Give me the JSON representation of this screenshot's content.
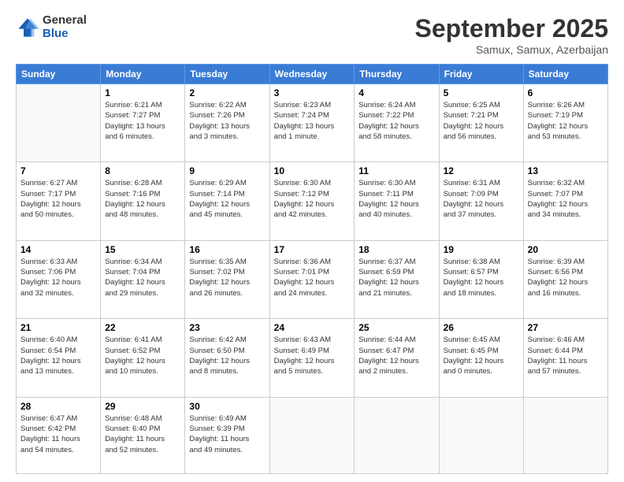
{
  "header": {
    "logo_general": "General",
    "logo_blue": "Blue",
    "title": "September 2025",
    "location": "Samux, Samux, Azerbaijan"
  },
  "days_of_week": [
    "Sunday",
    "Monday",
    "Tuesday",
    "Wednesday",
    "Thursday",
    "Friday",
    "Saturday"
  ],
  "weeks": [
    [
      {
        "day": "",
        "info": ""
      },
      {
        "day": "1",
        "info": "Sunrise: 6:21 AM\nSunset: 7:27 PM\nDaylight: 13 hours\nand 6 minutes."
      },
      {
        "day": "2",
        "info": "Sunrise: 6:22 AM\nSunset: 7:26 PM\nDaylight: 13 hours\nand 3 minutes."
      },
      {
        "day": "3",
        "info": "Sunrise: 6:23 AM\nSunset: 7:24 PM\nDaylight: 13 hours\nand 1 minute."
      },
      {
        "day": "4",
        "info": "Sunrise: 6:24 AM\nSunset: 7:22 PM\nDaylight: 12 hours\nand 58 minutes."
      },
      {
        "day": "5",
        "info": "Sunrise: 6:25 AM\nSunset: 7:21 PM\nDaylight: 12 hours\nand 56 minutes."
      },
      {
        "day": "6",
        "info": "Sunrise: 6:26 AM\nSunset: 7:19 PM\nDaylight: 12 hours\nand 53 minutes."
      }
    ],
    [
      {
        "day": "7",
        "info": "Sunrise: 6:27 AM\nSunset: 7:17 PM\nDaylight: 12 hours\nand 50 minutes."
      },
      {
        "day": "8",
        "info": "Sunrise: 6:28 AM\nSunset: 7:16 PM\nDaylight: 12 hours\nand 48 minutes."
      },
      {
        "day": "9",
        "info": "Sunrise: 6:29 AM\nSunset: 7:14 PM\nDaylight: 12 hours\nand 45 minutes."
      },
      {
        "day": "10",
        "info": "Sunrise: 6:30 AM\nSunset: 7:12 PM\nDaylight: 12 hours\nand 42 minutes."
      },
      {
        "day": "11",
        "info": "Sunrise: 6:30 AM\nSunset: 7:11 PM\nDaylight: 12 hours\nand 40 minutes."
      },
      {
        "day": "12",
        "info": "Sunrise: 6:31 AM\nSunset: 7:09 PM\nDaylight: 12 hours\nand 37 minutes."
      },
      {
        "day": "13",
        "info": "Sunrise: 6:32 AM\nSunset: 7:07 PM\nDaylight: 12 hours\nand 34 minutes."
      }
    ],
    [
      {
        "day": "14",
        "info": "Sunrise: 6:33 AM\nSunset: 7:06 PM\nDaylight: 12 hours\nand 32 minutes."
      },
      {
        "day": "15",
        "info": "Sunrise: 6:34 AM\nSunset: 7:04 PM\nDaylight: 12 hours\nand 29 minutes."
      },
      {
        "day": "16",
        "info": "Sunrise: 6:35 AM\nSunset: 7:02 PM\nDaylight: 12 hours\nand 26 minutes."
      },
      {
        "day": "17",
        "info": "Sunrise: 6:36 AM\nSunset: 7:01 PM\nDaylight: 12 hours\nand 24 minutes."
      },
      {
        "day": "18",
        "info": "Sunrise: 6:37 AM\nSunset: 6:59 PM\nDaylight: 12 hours\nand 21 minutes."
      },
      {
        "day": "19",
        "info": "Sunrise: 6:38 AM\nSunset: 6:57 PM\nDaylight: 12 hours\nand 18 minutes."
      },
      {
        "day": "20",
        "info": "Sunrise: 6:39 AM\nSunset: 6:56 PM\nDaylight: 12 hours\nand 16 minutes."
      }
    ],
    [
      {
        "day": "21",
        "info": "Sunrise: 6:40 AM\nSunset: 6:54 PM\nDaylight: 12 hours\nand 13 minutes."
      },
      {
        "day": "22",
        "info": "Sunrise: 6:41 AM\nSunset: 6:52 PM\nDaylight: 12 hours\nand 10 minutes."
      },
      {
        "day": "23",
        "info": "Sunrise: 6:42 AM\nSunset: 6:50 PM\nDaylight: 12 hours\nand 8 minutes."
      },
      {
        "day": "24",
        "info": "Sunrise: 6:43 AM\nSunset: 6:49 PM\nDaylight: 12 hours\nand 5 minutes."
      },
      {
        "day": "25",
        "info": "Sunrise: 6:44 AM\nSunset: 6:47 PM\nDaylight: 12 hours\nand 2 minutes."
      },
      {
        "day": "26",
        "info": "Sunrise: 6:45 AM\nSunset: 6:45 PM\nDaylight: 12 hours\nand 0 minutes."
      },
      {
        "day": "27",
        "info": "Sunrise: 6:46 AM\nSunset: 6:44 PM\nDaylight: 11 hours\nand 57 minutes."
      }
    ],
    [
      {
        "day": "28",
        "info": "Sunrise: 6:47 AM\nSunset: 6:42 PM\nDaylight: 11 hours\nand 54 minutes."
      },
      {
        "day": "29",
        "info": "Sunrise: 6:48 AM\nSunset: 6:40 PM\nDaylight: 11 hours\nand 52 minutes."
      },
      {
        "day": "30",
        "info": "Sunrise: 6:49 AM\nSunset: 6:39 PM\nDaylight: 11 hours\nand 49 minutes."
      },
      {
        "day": "",
        "info": ""
      },
      {
        "day": "",
        "info": ""
      },
      {
        "day": "",
        "info": ""
      },
      {
        "day": "",
        "info": ""
      }
    ]
  ]
}
